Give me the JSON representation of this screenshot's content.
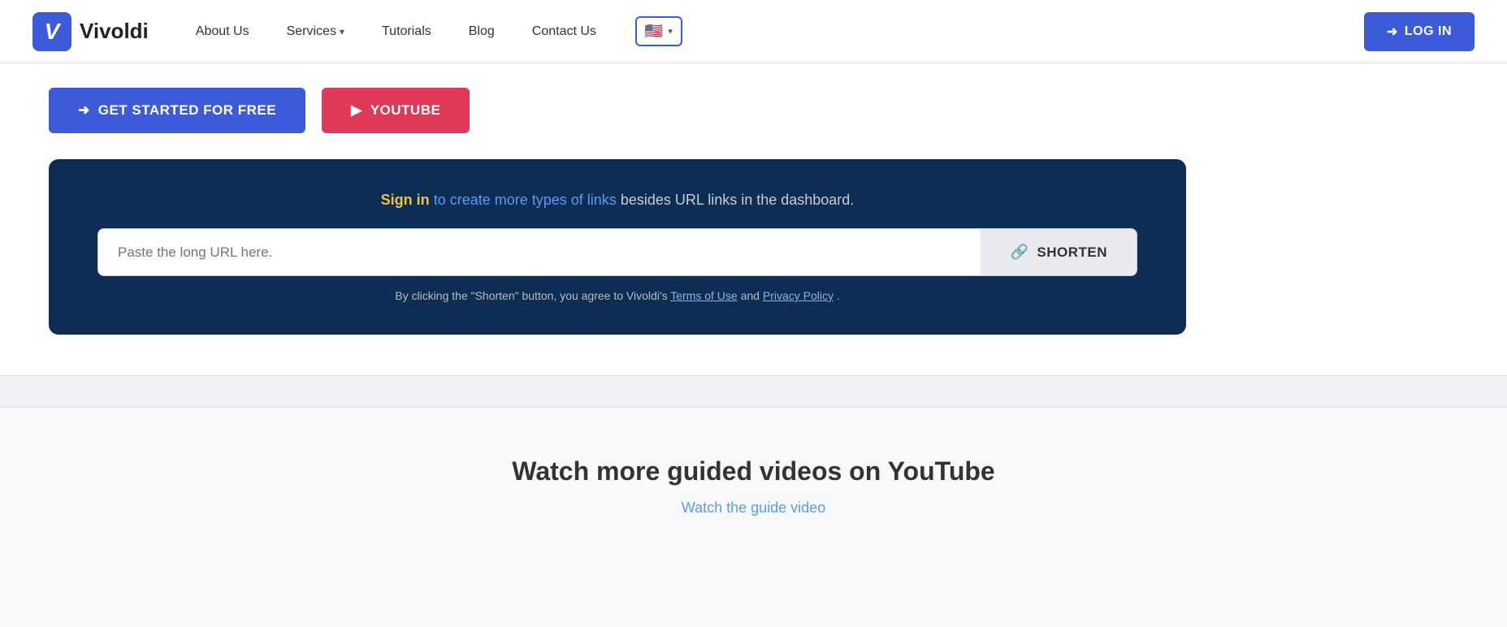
{
  "brand": {
    "logo_letter": "V",
    "name": "Vivoldi"
  },
  "nav": {
    "about_label": "About Us",
    "services_label": "Services",
    "tutorials_label": "Tutorials",
    "blog_label": "Blog",
    "contact_label": "Contact Us",
    "lang_flag": "🇺🇸",
    "login_label": "LOG IN"
  },
  "buttons": {
    "get_started_label": "GET STARTED FOR FREE",
    "youtube_label": "YOUTUBE"
  },
  "shortener": {
    "headline_prefix": "",
    "sign_in_text": "Sign in",
    "create_types_text": "to create more types of links",
    "headline_suffix": " besides URL links in the dashboard.",
    "input_placeholder": "Paste the long URL here.",
    "shorten_label": "SHORTEN",
    "terms_prefix": "By clicking the \"Shorten\" button, you agree to Vivoldi's ",
    "terms_of_use": "Terms of Use",
    "terms_middle": " and ",
    "privacy_policy": "Privacy Policy",
    "terms_suffix": "."
  },
  "youtube_section": {
    "title": "Watch more guided videos on YouTube",
    "watch_link": "Watch the guide video"
  }
}
